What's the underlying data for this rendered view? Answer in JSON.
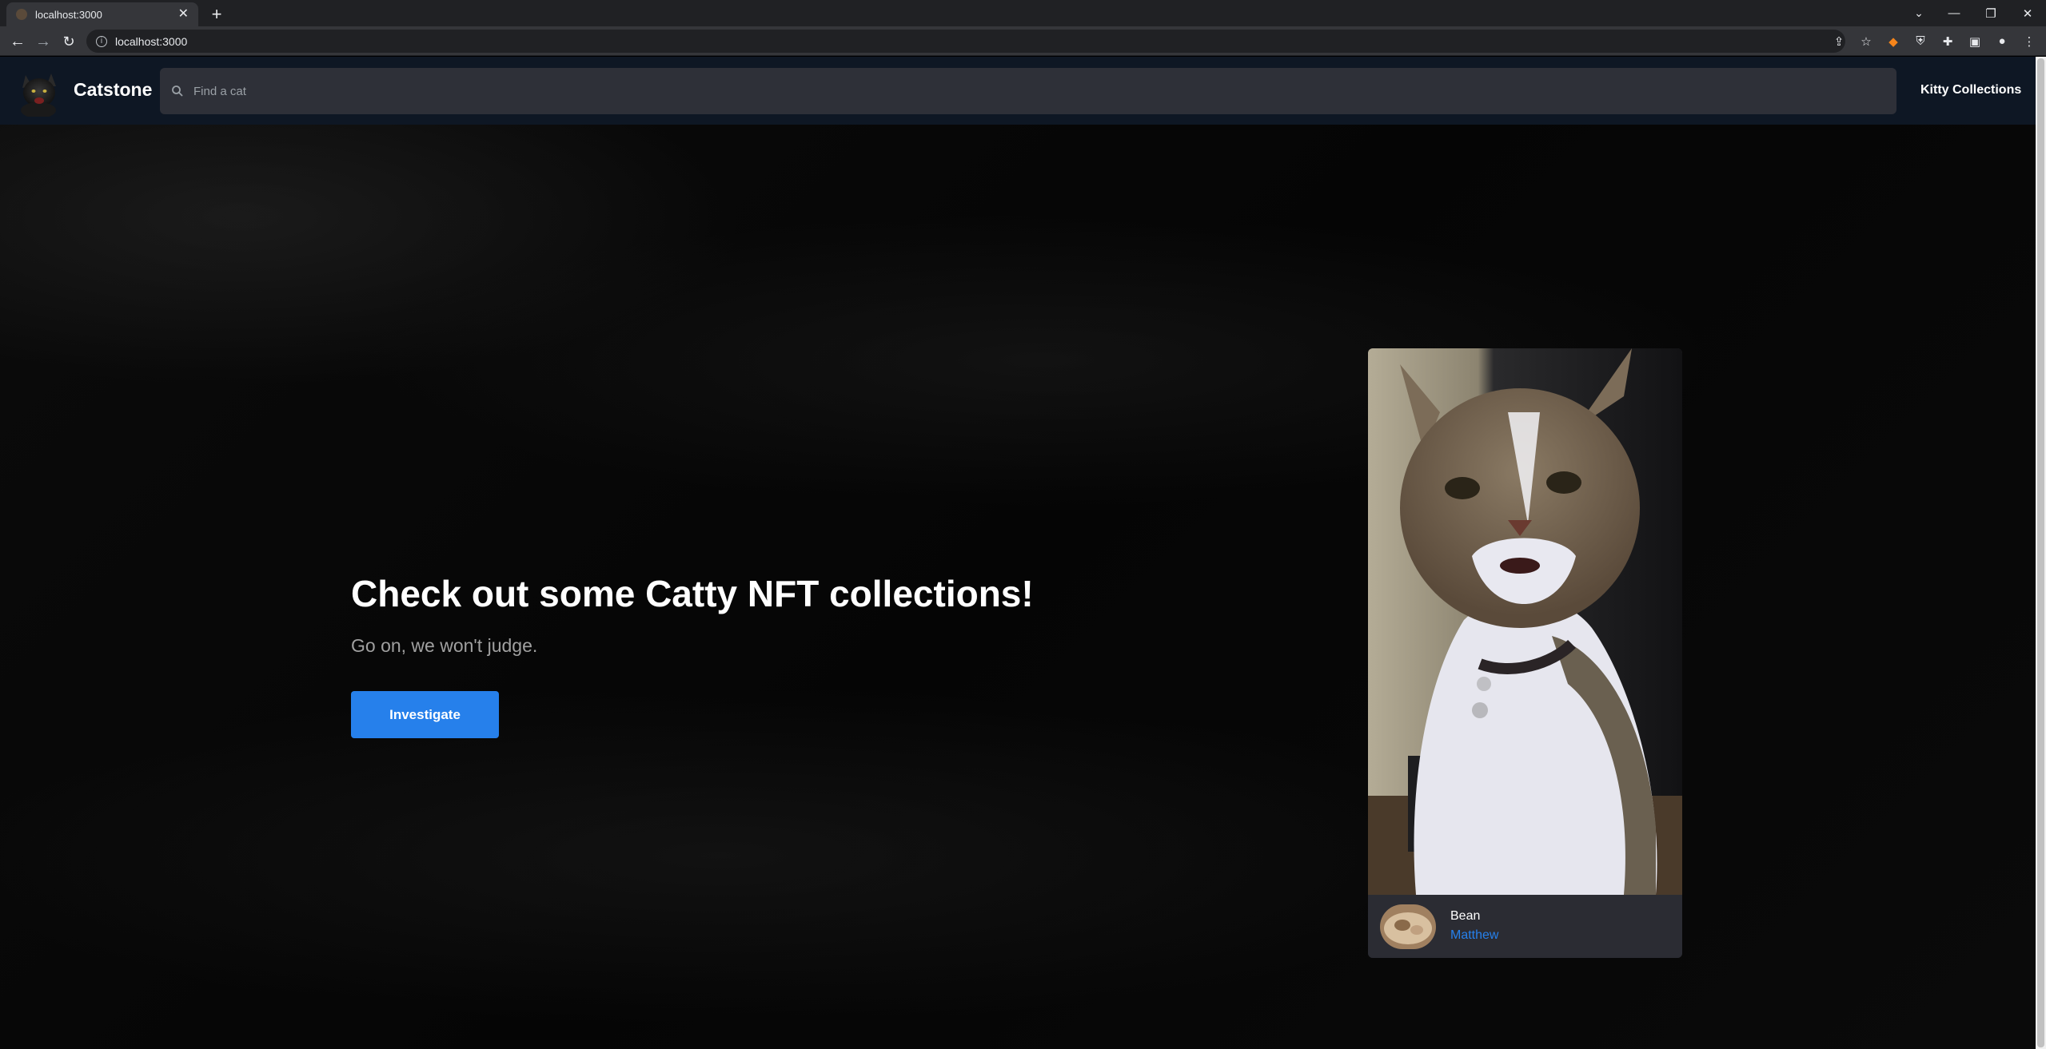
{
  "browser": {
    "tab_title": "localhost:3000",
    "address": "localhost:3000"
  },
  "navbar": {
    "brand": "Catstone",
    "search_placeholder": "Find a cat",
    "link": "Kitty Collections"
  },
  "hero": {
    "title": "Check out some Catty NFT collections!",
    "subtitle": "Go on, we won't judge.",
    "cta": "Investigate"
  },
  "card": {
    "name": "Bean",
    "owner": "Matthew"
  },
  "colors": {
    "accent": "#2680eb",
    "navbar_bg": "#0e1724",
    "search_bg": "#2e3038",
    "card_bg": "#2b2c33"
  }
}
